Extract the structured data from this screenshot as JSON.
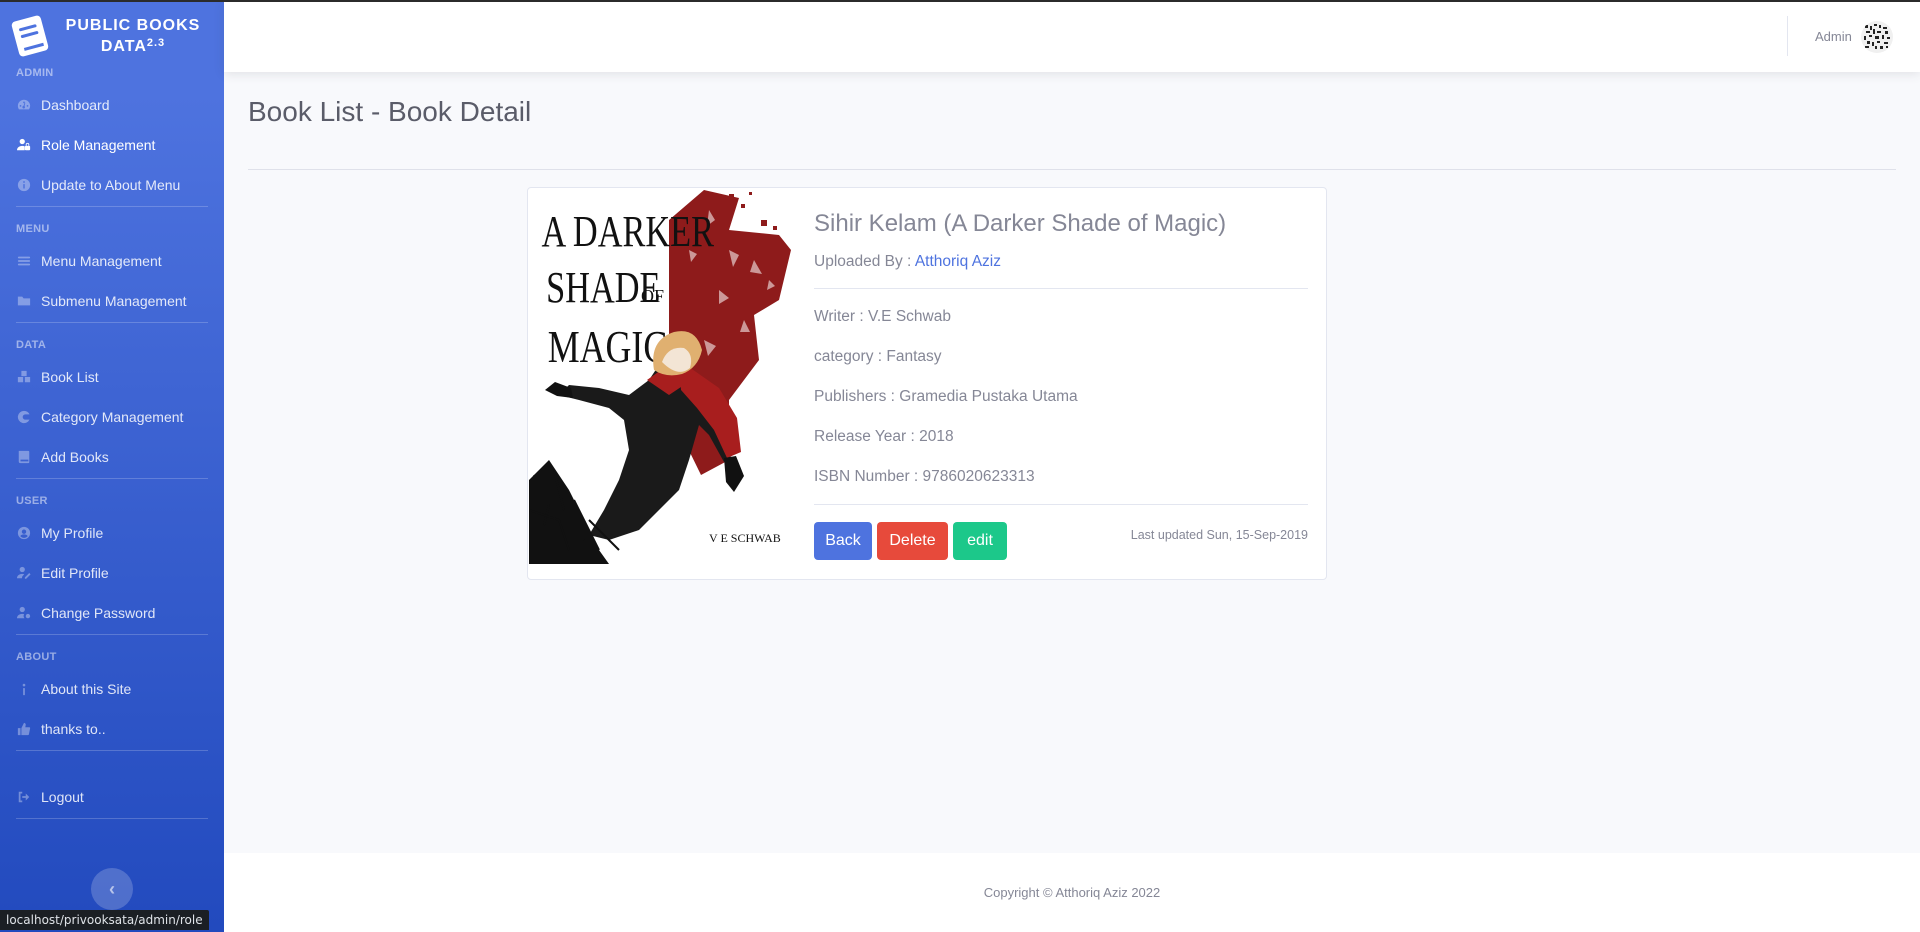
{
  "brand": {
    "title": "PUBLIC BOOKS DATA",
    "version": "2.3"
  },
  "sidebar": {
    "sections": [
      {
        "heading": "ADMIN",
        "items": [
          {
            "label": "Dashboard",
            "icon": "dashboard-icon"
          },
          {
            "label": "Role Management",
            "icon": "user-lock-icon",
            "active": true
          },
          {
            "label": "Update to About Menu",
            "icon": "info-icon"
          }
        ]
      },
      {
        "heading": "MENU",
        "items": [
          {
            "label": "Menu Management",
            "icon": "list-icon"
          },
          {
            "label": "Submenu Management",
            "icon": "folder-icon"
          }
        ]
      },
      {
        "heading": "DATA",
        "items": [
          {
            "label": "Book List",
            "icon": "boxes-icon"
          },
          {
            "label": "Category Management",
            "icon": "category-icon"
          },
          {
            "label": "Add Books",
            "icon": "book-icon"
          }
        ]
      },
      {
        "heading": "USER",
        "items": [
          {
            "label": "My Profile",
            "icon": "user-circle-icon"
          },
          {
            "label": "Edit Profile",
            "icon": "user-edit-icon"
          },
          {
            "label": "Change Password",
            "icon": "user-cog-icon"
          }
        ]
      },
      {
        "heading": "ABOUT",
        "items": [
          {
            "label": "About this Site",
            "icon": "info-icon"
          },
          {
            "label": "thanks to..",
            "icon": "thumbs-up-icon"
          }
        ]
      }
    ],
    "logout": {
      "label": "Logout",
      "icon": "sign-out-icon"
    }
  },
  "status_url": "localhost/privooksata/admin/role",
  "topbar": {
    "user_name": "Admin"
  },
  "page": {
    "title": "Book List - Book Detail"
  },
  "book": {
    "cover_title_lines": [
      "A DARKER",
      "SHADE",
      "OF",
      "MAGIC"
    ],
    "cover_author": "V E SCHWAB",
    "title": "Sihir Kelam (A Darker Shade of Magic)",
    "uploaded_label": "Uploaded By : ",
    "uploaded_by": "Atthoriq Aziz",
    "writer": "Writer : V.E Schwab",
    "category": "category : Fantasy",
    "publisher": "Publishers : Gramedia Pustaka Utama",
    "release_year": "Release Year : 2018",
    "isbn": "ISBN Number : 9786020623313",
    "last_updated": "Last updated Sun, 15-Sep-2019"
  },
  "actions": {
    "back": "Back",
    "delete": "Delete",
    "edit": "edit"
  },
  "footer": {
    "copyright": "Copyright © Atthoriq Aziz 2022"
  },
  "colors": {
    "primary": "#4e73df",
    "danger": "#e74a3b",
    "success": "#1cc88a"
  }
}
